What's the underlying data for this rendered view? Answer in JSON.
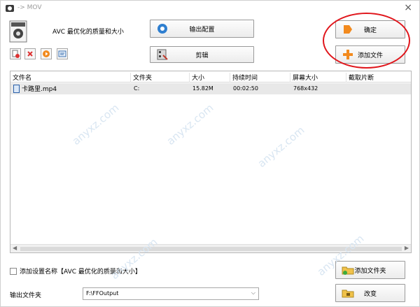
{
  "titlebar": {
    "title": "-> MOV",
    "close": "×"
  },
  "profile": {
    "text": "AVC 最优化的质量和大小"
  },
  "buttons": {
    "output_config": "输出配置",
    "edit": "剪辑",
    "ok": "确定",
    "add_file": "添加文件",
    "add_folder": "添加文件夹",
    "change": "改变"
  },
  "list": {
    "columns": [
      "文件名",
      "文件夹",
      "大小",
      "持续时间",
      "屏幕大小",
      "截取片断"
    ],
    "rows": [
      {
        "name": "卡路里.mp4",
        "folder": "C:",
        "size": "15.82M",
        "duration": "00:02:50",
        "screen": "768x432",
        "clip": ""
      }
    ],
    "scroll_left": "◀",
    "scroll_right": "▶"
  },
  "options": {
    "add_setting_name": "添加设置名称【AVC 最优化的质量和大小】"
  },
  "output": {
    "label": "输出文件夹",
    "value": "F:\\FFOutput",
    "chevron": "⌵"
  },
  "watermark": {
    "text": "anyxz.com"
  },
  "colors": {
    "highlight_ring": "#e0161c",
    "row_bg": "#e8e8e8",
    "accent_orange": "#f28a1e"
  }
}
